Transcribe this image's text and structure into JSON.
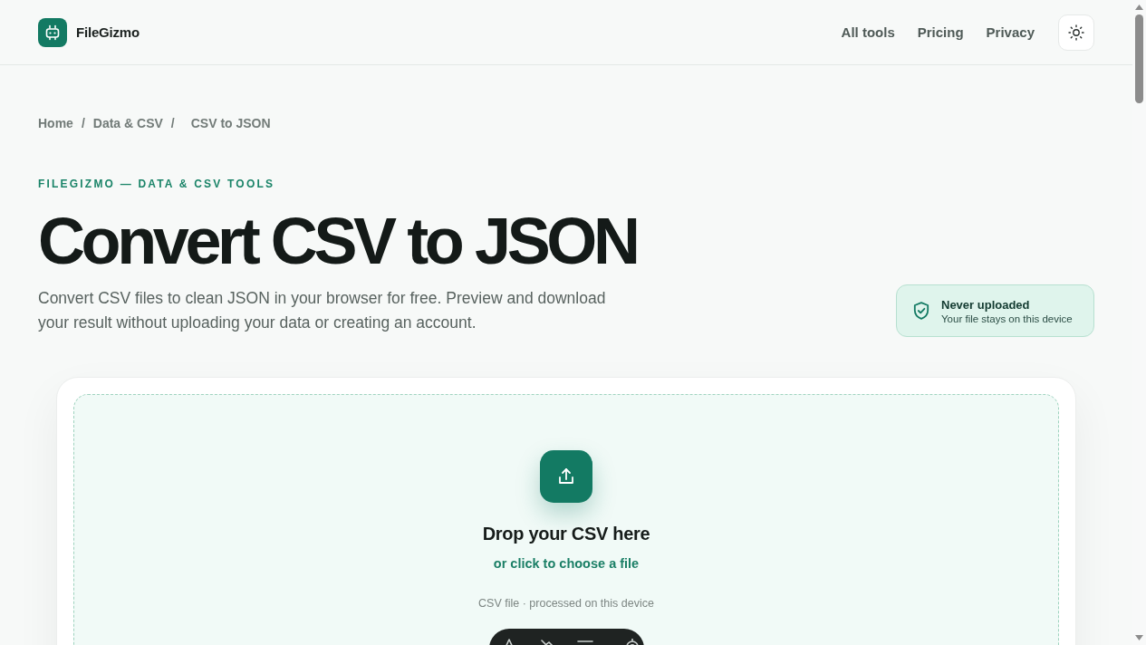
{
  "header": {
    "brand": "FileGizmo",
    "nav": [
      "All tools",
      "Pricing",
      "Privacy"
    ]
  },
  "breadcrumb": [
    {
      "kind": "link",
      "label": "Home"
    },
    {
      "kind": "separator",
      "label": "/"
    },
    {
      "kind": "link",
      "label": "Data & CSV"
    },
    {
      "kind": "separator",
      "label": "/"
    },
    {
      "kind": "current",
      "label": "CSV to JSON"
    }
  ],
  "hero": {
    "eyebrow": "FILEGIZMO — DATA & CSV TOOLS",
    "title": "Convert CSV to JSON",
    "description": "Convert CSV files to clean JSON in your browser for free. Preview and download your result without uploading your data or creating an account."
  },
  "privacy_badge": {
    "title": "Never uploaded",
    "subtitle": "Your file stays on this device"
  },
  "upload": {
    "title": "Drop your CSV here",
    "link": "or click to choose a file",
    "hint": "CSV file · processed on this device"
  }
}
